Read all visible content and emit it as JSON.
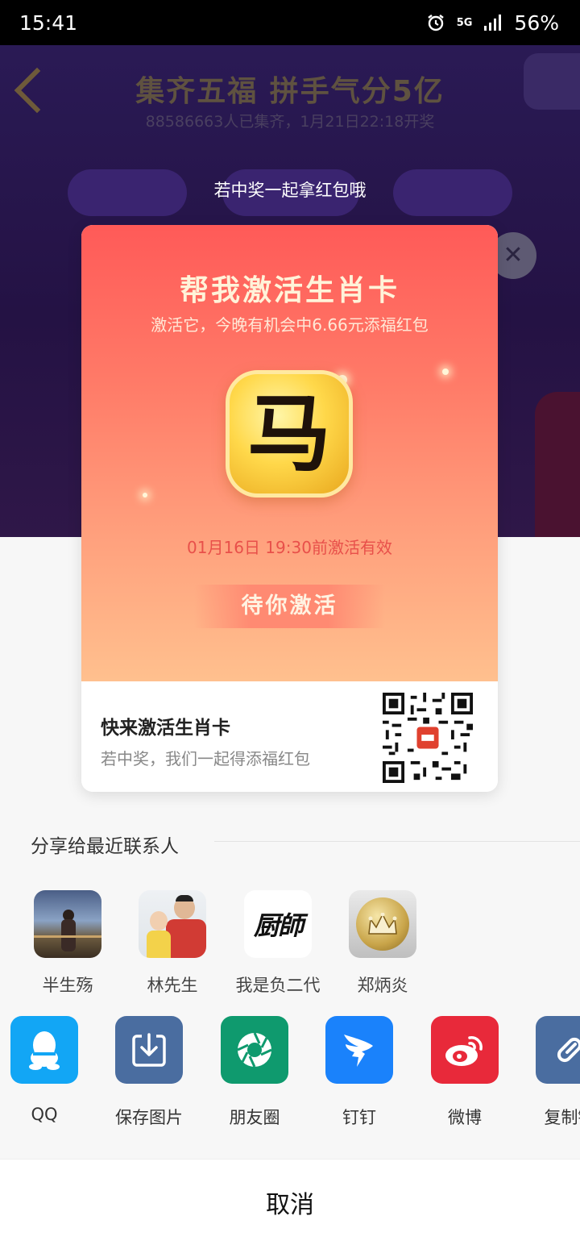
{
  "status_bar": {
    "time": "15:41",
    "network": "5G",
    "battery": "56%",
    "icons": [
      "alarm-icon",
      "network-5g-icon",
      "signal-icon"
    ]
  },
  "background_page": {
    "title": "集齐五福 拼手气分5亿",
    "subtitle": "88586663人已集齐，1月21日22:18开奖"
  },
  "overlay_hint": "若中奖一起拿红包哦",
  "card": {
    "title": "帮我激活生肖卡",
    "subtitle": "激活它，今晚有机会中6.66元添福红包",
    "zodiac_char": "马",
    "expiry": "01月16日 19:30前激活有效",
    "cta": "待你激活",
    "bottom_title": "快来激活生肖卡",
    "bottom_subtitle": "若中奖，我们一起得添福红包"
  },
  "recent_contacts": {
    "title": "分享给最近联系人",
    "items": [
      {
        "name": "半生殇",
        "avatar_icon": "landscape-person-avatar"
      },
      {
        "name": "林先生",
        "avatar_icon": "family-photo-avatar"
      },
      {
        "name": "我是负二代",
        "avatar_icon": "calligraphy-avatar",
        "avatar_text": "厨師"
      },
      {
        "name": "郑炳炎",
        "avatar_icon": "crown-logo-avatar"
      }
    ]
  },
  "share_targets": [
    {
      "label": "QQ",
      "icon": "qq-icon",
      "color": "#12a6f5"
    },
    {
      "label": "保存图片",
      "icon": "save-image-icon",
      "color": "#4a6da0"
    },
    {
      "label": "朋友圈",
      "icon": "moments-icon",
      "color": "#0f9a6e"
    },
    {
      "label": "钉钉",
      "icon": "dingtalk-icon",
      "color": "#1a82fb"
    },
    {
      "label": "微博",
      "icon": "weibo-icon",
      "color": "#e8293a"
    },
    {
      "label": "复制链",
      "icon": "copy-link-icon",
      "color": "#4a6da0"
    }
  ],
  "cancel_label": "取消"
}
